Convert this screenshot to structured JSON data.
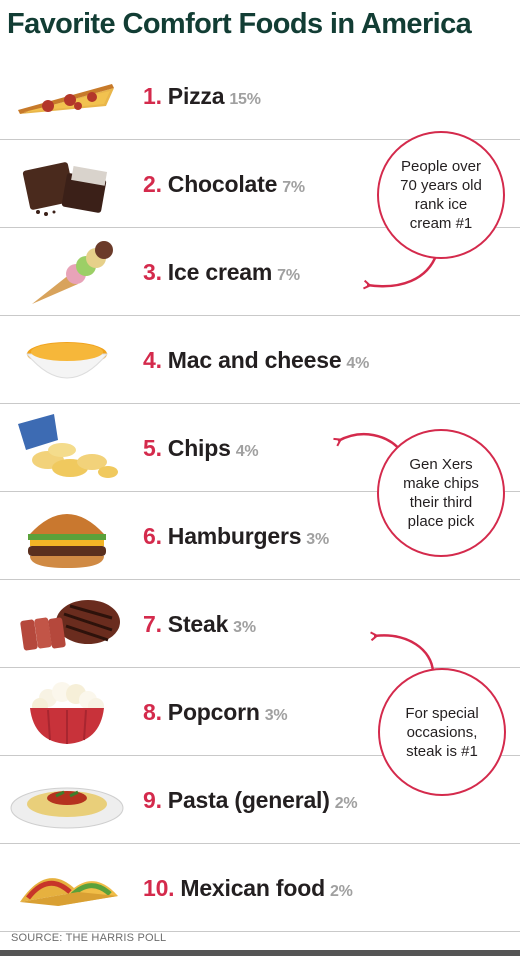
{
  "title": "Favorite Comfort Foods in America",
  "source": "SOURCE: THE HARRIS POLL",
  "colors": {
    "rank": "#d42a4c",
    "title": "#123d34",
    "percent": "#a0a0a0",
    "bubble_border": "#d42a4c"
  },
  "chart_data": {
    "type": "table",
    "title": "Favorite Comfort Foods in America",
    "columns": [
      "rank",
      "food",
      "percent"
    ],
    "rows": [
      {
        "rank": "1.",
        "food": "Pizza",
        "percent": "15%",
        "value": 15,
        "icon": "pizza-slice-icon"
      },
      {
        "rank": "2.",
        "food": "Chocolate",
        "percent": "7%",
        "value": 7,
        "icon": "chocolate-bar-icon"
      },
      {
        "rank": "3.",
        "food": "Ice cream",
        "percent": "7%",
        "value": 7,
        "icon": "ice-cream-cone-icon"
      },
      {
        "rank": "4.",
        "food": "Mac and cheese",
        "percent": "4%",
        "value": 4,
        "icon": "mac-and-cheese-bowl-icon"
      },
      {
        "rank": "5.",
        "food": "Chips",
        "percent": "4%",
        "value": 4,
        "icon": "potato-chips-icon"
      },
      {
        "rank": "6.",
        "food": "Hamburgers",
        "percent": "3%",
        "value": 3,
        "icon": "hamburger-icon"
      },
      {
        "rank": "7.",
        "food": "Steak",
        "percent": "3%",
        "value": 3,
        "icon": "steak-icon"
      },
      {
        "rank": "8.",
        "food": "Popcorn",
        "percent": "3%",
        "value": 3,
        "icon": "popcorn-bowl-icon"
      },
      {
        "rank": "9.",
        "food": "Pasta (general)",
        "percent": "2%",
        "value": 2,
        "icon": "pasta-plate-icon"
      },
      {
        "rank": "10.",
        "food": "Mexican food",
        "percent": "2%",
        "value": 2,
        "icon": "tacos-icon"
      }
    ],
    "annotations": [
      {
        "text": "People over 70 years old rank ice cream #1",
        "points_to": "Ice cream"
      },
      {
        "text": "Gen Xers make chips their third place pick",
        "points_to": "Chips"
      },
      {
        "text": "For special occasions, steak is #1",
        "points_to": "Steak"
      }
    ]
  }
}
